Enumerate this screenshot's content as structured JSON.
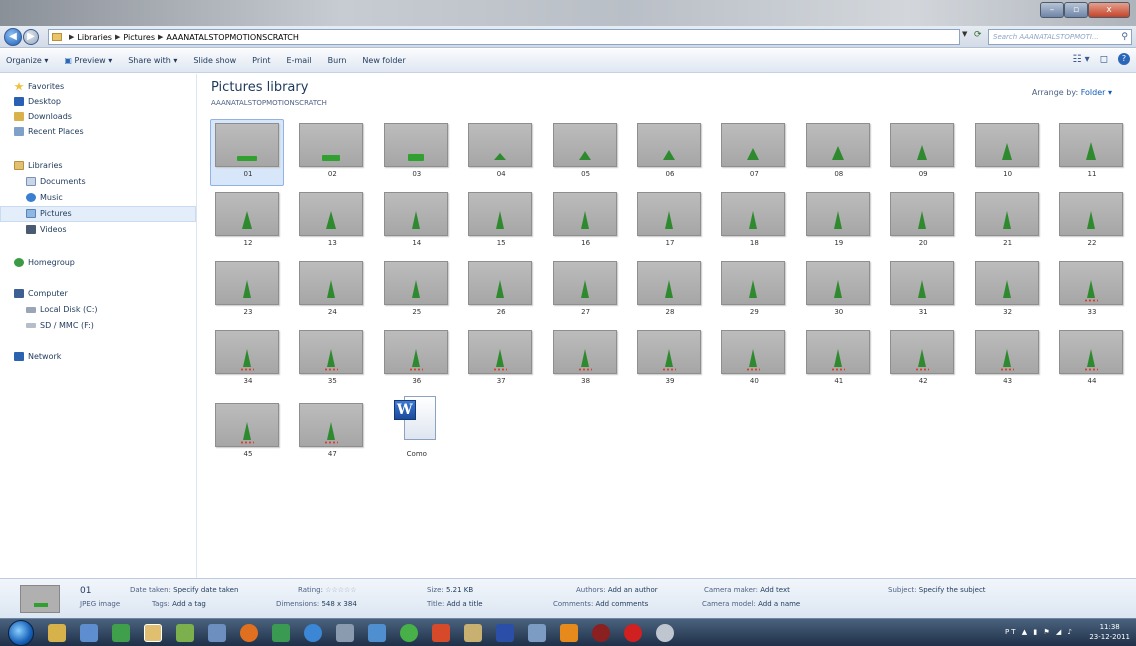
{
  "window": {
    "min_label": "–",
    "max_label": "▫",
    "close_label": "x"
  },
  "nav": {
    "crumbs": [
      "Libraries",
      "Pictures",
      "AAANATALSTOPMOTIONSCRATCH"
    ],
    "search_placeholder": "Search AAANATALSTOPMOTI..."
  },
  "toolbar": {
    "organize": "Organize ▾",
    "preview": "Preview ▾",
    "share": "Share with ▾",
    "slideshow": "Slide show",
    "print": "Print",
    "email": "E-mail",
    "burn": "Burn",
    "newfolder": "New folder"
  },
  "sidebar": {
    "favorites": "Favorites",
    "desktop": "Desktop",
    "downloads": "Downloads",
    "recent": "Recent Places",
    "libraries": "Libraries",
    "documents": "Documents",
    "music": "Music",
    "pictures": "Pictures",
    "videos": "Videos",
    "homegroup": "Homegroup",
    "computer": "Computer",
    "localdisk": "Local Disk (C:)",
    "sdmmc": "SD / MMC (F:)",
    "network": "Network"
  },
  "content": {
    "title": "Pictures library",
    "subtitle": "AAANATALSTOPMOTIONSCRATCH",
    "arrange_label": "Arrange by:",
    "arrange_value": "Folder ▾",
    "files": [
      "01",
      "02",
      "03",
      "04",
      "05",
      "06",
      "07",
      "08",
      "09",
      "10",
      "11",
      "12",
      "13",
      "14",
      "15",
      "16",
      "17",
      "18",
      "19",
      "20",
      "21",
      "22",
      "23",
      "24",
      "25",
      "26",
      "27",
      "28",
      "29",
      "30",
      "31",
      "32",
      "33",
      "34",
      "35",
      "36",
      "37",
      "38",
      "39",
      "40",
      "41",
      "42",
      "43",
      "44",
      "45",
      "47",
      "Como"
    ],
    "selected": "01"
  },
  "details": {
    "name": "01",
    "type": "JPEG image",
    "date_taken_label": "Date taken:",
    "date_taken_value": "Specify date taken",
    "tags_label": "Tags:",
    "tags_value": "Add a tag",
    "rating_label": "Rating:",
    "rating_value": "☆☆☆☆☆",
    "dimensions_label": "Dimensions:",
    "dimensions_value": "548 x 384",
    "size_label": "Size:",
    "size_value": "5.21 KB",
    "title_label": "Title:",
    "title_value": "Add a title",
    "authors_label": "Authors:",
    "authors_value": "Add an author",
    "comments_label": "Comments:",
    "comments_value": "Add comments",
    "camera_maker_label": "Camera maker:",
    "camera_maker_value": "Add text",
    "camera_model_label": "Camera model:",
    "camera_model_value": "Add a name",
    "subject_label": "Subject:",
    "subject_value": "Specify the subject"
  },
  "taskbar": {
    "lang": "PT",
    "time": "11:38",
    "date": "23-12-2011"
  }
}
